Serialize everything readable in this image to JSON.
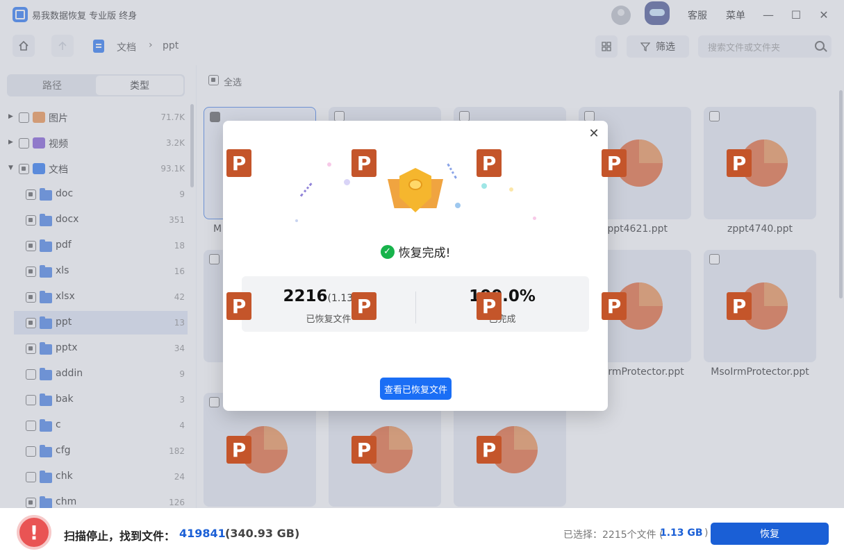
{
  "app": {
    "title": "易我数据恢复 专业版 终身",
    "service": "客服",
    "menu": "菜单"
  },
  "window": {
    "minimize": "—",
    "maximize": "☐",
    "close": "✕"
  },
  "breadcrumb": {
    "root": "文档",
    "current": "ppt"
  },
  "toolbar": {
    "filter_label": "筛选",
    "search_placeholder": "搜索文件或文件夹"
  },
  "sidebar": {
    "tab_path": "路径",
    "tab_type": "类型",
    "items": [
      {
        "label": "图片",
        "count": "71.7K"
      },
      {
        "label": "视频",
        "count": "3.2K"
      },
      {
        "label": "文档",
        "count": "93.1K"
      },
      {
        "label": "doc",
        "count": "9"
      },
      {
        "label": "docx",
        "count": "351"
      },
      {
        "label": "pdf",
        "count": "18"
      },
      {
        "label": "xls",
        "count": "16"
      },
      {
        "label": "xlsx",
        "count": "42"
      },
      {
        "label": "ppt",
        "count": "13"
      },
      {
        "label": "pptx",
        "count": "34"
      },
      {
        "label": "addin",
        "count": "9"
      },
      {
        "label": "bak",
        "count": "3"
      },
      {
        "label": "c",
        "count": "4"
      },
      {
        "label": "cfg",
        "count": "182"
      },
      {
        "label": "chk",
        "count": "24"
      },
      {
        "label": "chm",
        "count": "126"
      }
    ]
  },
  "content": {
    "select_all": "全选",
    "files": [
      {
        "name": "M"
      },
      {
        "name": ""
      },
      {
        "name": ""
      },
      {
        "name": "zppt4621.ppt"
      },
      {
        "name": "zppt4740.ppt"
      },
      {
        "name": ""
      },
      {
        "name": ""
      },
      {
        "name": ""
      },
      {
        "name": "MsoIrmProtector.ppt"
      },
      {
        "name": "MsoIrmProtector.ppt"
      },
      {
        "name": ""
      },
      {
        "name": ""
      },
      {
        "name": ""
      }
    ]
  },
  "dialog": {
    "title": "恢复完成!",
    "recovered_count": "2216",
    "recovered_size": "(1.13 GB)",
    "recovered_label": "已恢复文件",
    "percent": "100.0%",
    "percent_label": "已完成",
    "view_button": "查看已恢复文件"
  },
  "footer": {
    "scan_label": "扫描停止，找到文件：",
    "scan_count": "419841",
    "scan_size": "(340.93 GB)",
    "selected_label": "已选择：2215个文件 (",
    "selected_size": "1.13 GB",
    "selected_close": ")",
    "recover_button": "恢复"
  },
  "colors": {
    "accent": "#1a6ef5",
    "success": "#17b34b",
    "warning": "#e95454",
    "ppt_orange": "#e35e29"
  }
}
